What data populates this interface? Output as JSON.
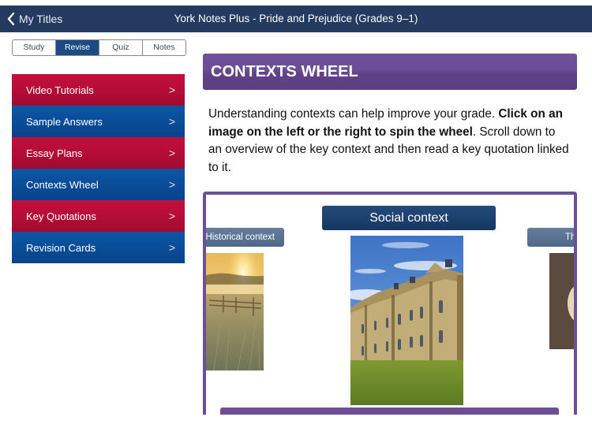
{
  "topbar": {
    "back_label": "My Titles",
    "title": "York Notes Plus - Pride and Prejudice (Grades 9–1)"
  },
  "segments": [
    {
      "label": "Study",
      "active": false
    },
    {
      "label": "Revise",
      "active": true
    },
    {
      "label": "Quiz",
      "active": false
    },
    {
      "label": "Notes",
      "active": false
    }
  ],
  "menu": {
    "chevron": ">",
    "items": [
      {
        "label": "Video Tutorials",
        "color": "red"
      },
      {
        "label": "Sample Answers",
        "color": "blue"
      },
      {
        "label": "Essay Plans",
        "color": "red"
      },
      {
        "label": "Contexts Wheel",
        "color": "blue"
      },
      {
        "label": "Key Quotations",
        "color": "red"
      },
      {
        "label": "Revision Cards",
        "color": "blue"
      }
    ]
  },
  "content": {
    "header": "CONTEXTS WHEEL",
    "intro_part1": "Understanding contexts can help improve your grade. ",
    "intro_bold": "Click on an image on the left or the right to spin the wheel",
    "intro_part2": ". Scroll down to an overview of the key context and then read a key quotation linked to it."
  },
  "wheel": {
    "center_label": "Social context",
    "left_label": "Historical context",
    "right_label": "Th",
    "images": {
      "left": "misty-sunrise-field-image",
      "center": "stately-home-image",
      "right": "portrait-image"
    }
  },
  "colors": {
    "topbar": "#243a5e",
    "accent_purple": "#6c4f96",
    "menu_red": "#b50d38",
    "menu_blue": "#0a4d98",
    "segment_active": "#1c4a84"
  }
}
